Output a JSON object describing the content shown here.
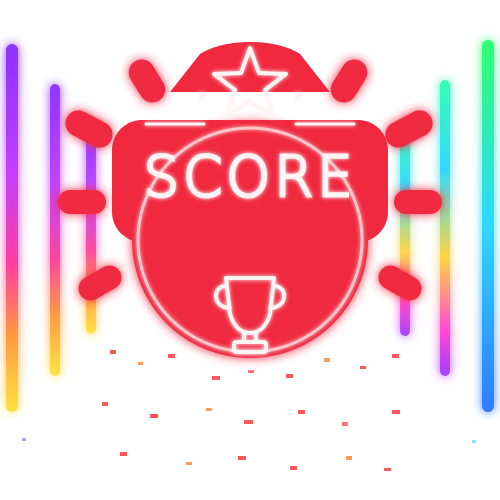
{
  "badge": {
    "title": "SCORE",
    "color_main": "#f0293f",
    "color_glow": "#ff4a5c",
    "color_line": "#fff4f4",
    "icons": [
      "star-icon",
      "trophy-icon"
    ]
  },
  "neon_tubes": {
    "colors": [
      "#9b35ff",
      "#ff3fd0",
      "#ff3a3a",
      "#ffe838",
      "#2aff6e",
      "#2aa8ff"
    ]
  }
}
